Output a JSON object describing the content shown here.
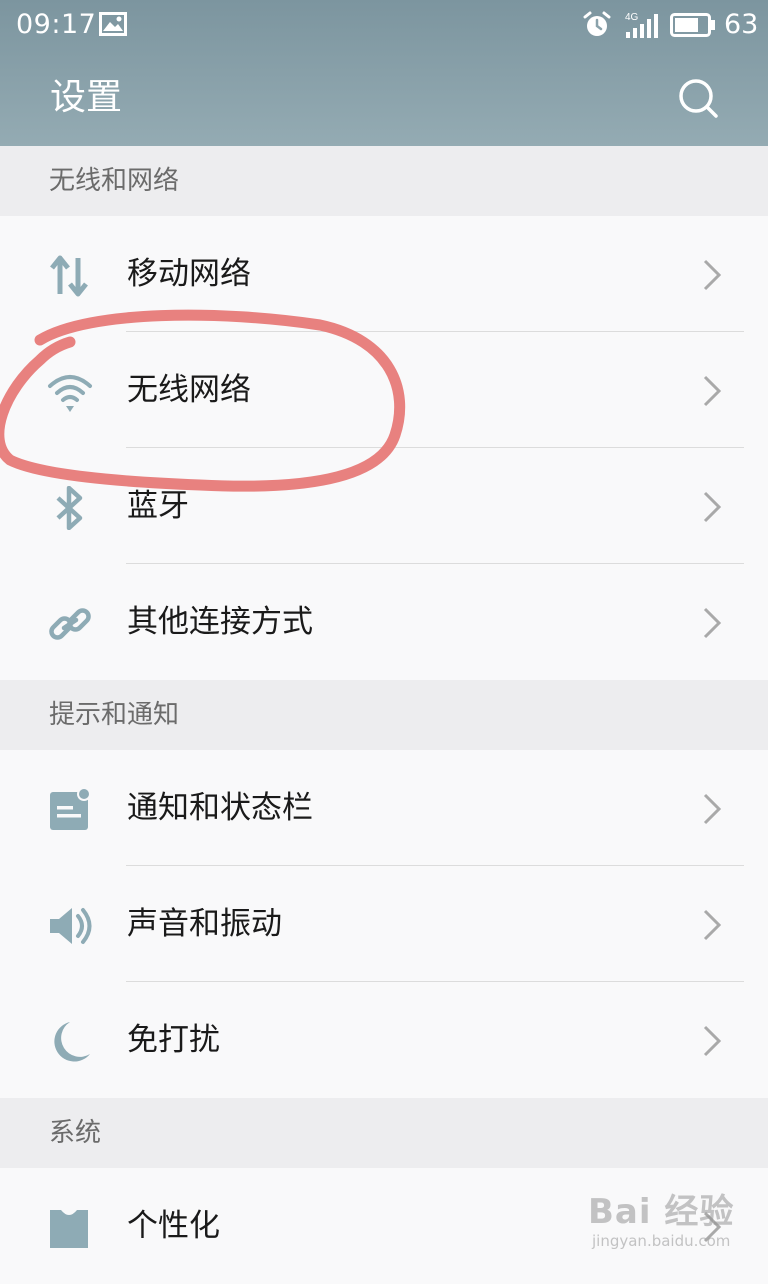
{
  "status_bar": {
    "time": "09:17",
    "network": "4G",
    "battery": "63"
  },
  "header": {
    "title": "设置",
    "search_icon": "search-icon"
  },
  "sections": [
    {
      "label": "无线和网络",
      "items": [
        {
          "label": "移动网络",
          "icon": "mobile-data-icon"
        },
        {
          "label": "无线网络",
          "icon": "wifi-icon"
        },
        {
          "label": "蓝牙",
          "icon": "bluetooth-icon"
        },
        {
          "label": "其他连接方式",
          "icon": "link-icon"
        }
      ]
    },
    {
      "label": "提示和通知",
      "items": [
        {
          "label": "通知和状态栏",
          "icon": "notification-icon"
        },
        {
          "label": "声音和振动",
          "icon": "speaker-icon"
        },
        {
          "label": "免打扰",
          "icon": "moon-icon"
        }
      ]
    },
    {
      "label": "系统",
      "items": [
        {
          "label": "个性化",
          "icon": "personalize-icon"
        }
      ]
    }
  ],
  "watermark": {
    "main": "Bai 经验",
    "sub": "jingyan.baidu.com"
  },
  "colors": {
    "header": "#8aa2ab",
    "icon": "#8eabb5",
    "annotation": "#e77a78",
    "section_bg": "#ededef"
  }
}
